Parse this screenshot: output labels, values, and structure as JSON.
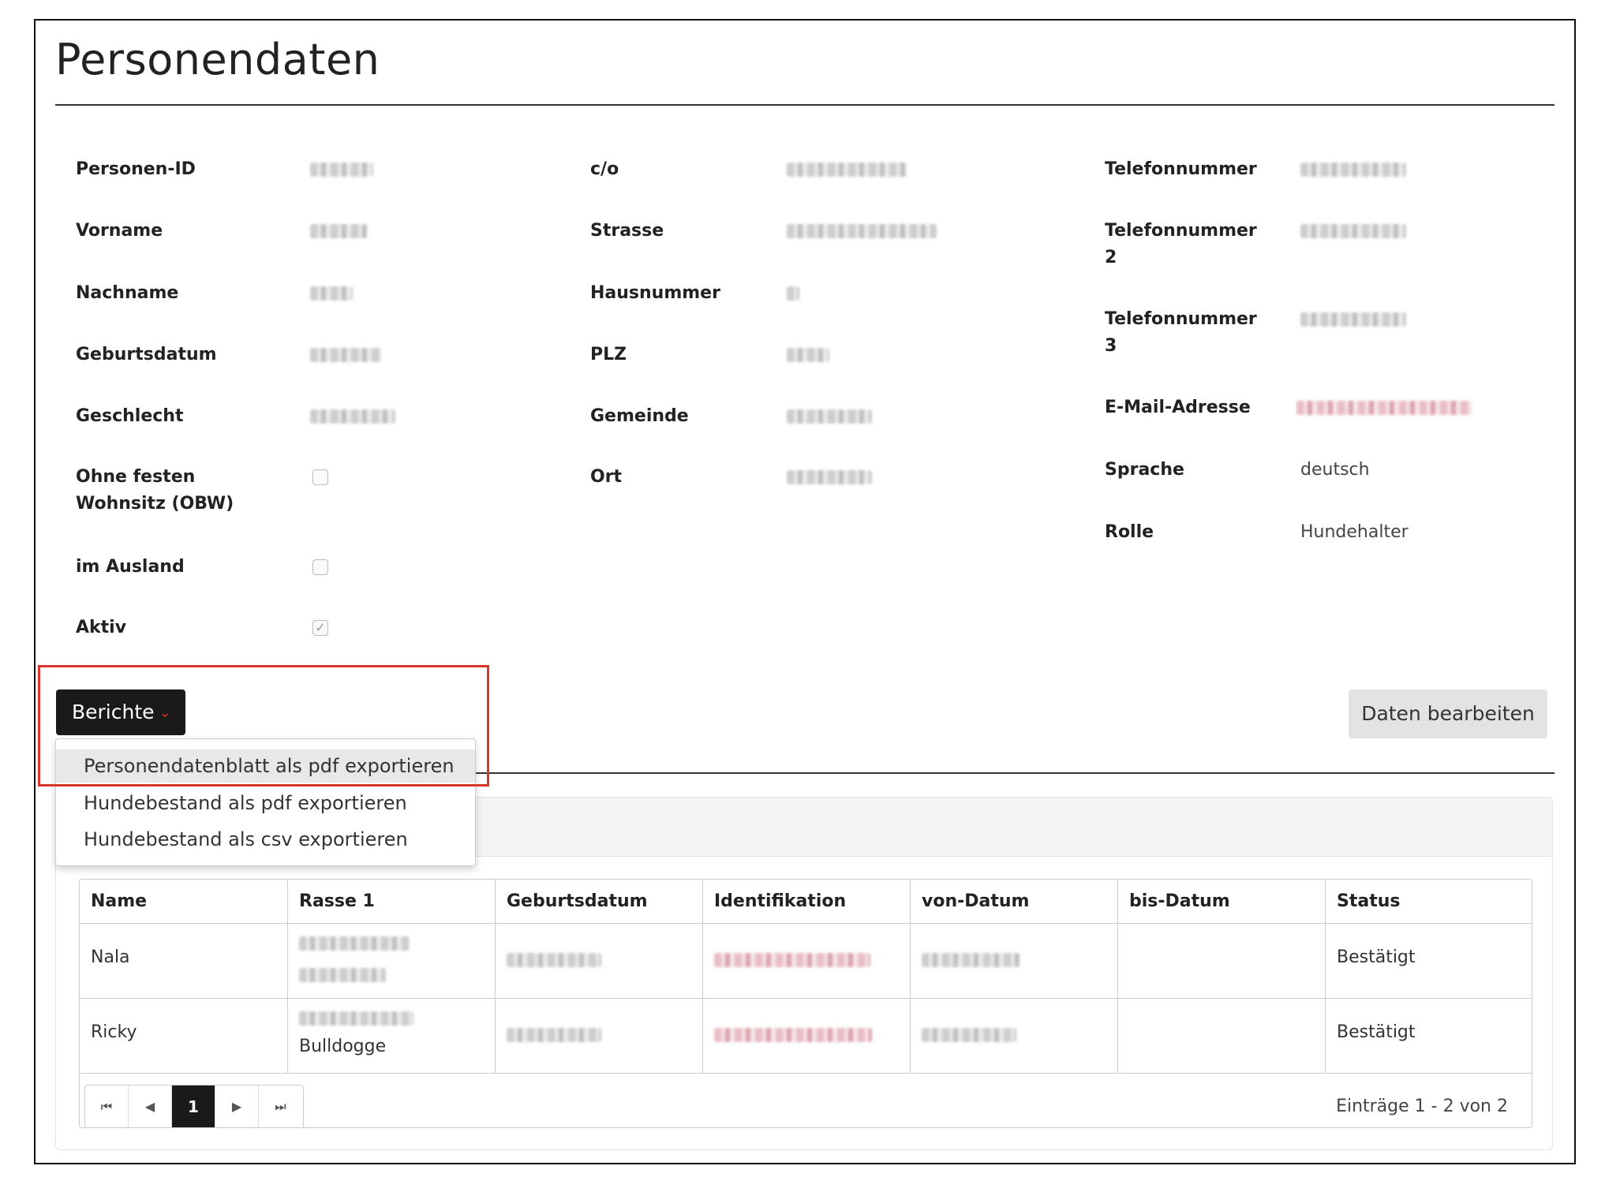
{
  "page": {
    "title": "Personendaten"
  },
  "col1": {
    "person_id": "Personen-ID",
    "vorname": "Vorname",
    "nachname": "Nachname",
    "geburtsdatum": "Geburtsdatum",
    "geschlecht": "Geschlecht",
    "ohne_festen_line1": "Ohne festen",
    "ohne_festen_line2": "Wohnsitz (OBW)",
    "im_ausland": "im Ausland",
    "aktiv": "Aktiv"
  },
  "col2": {
    "co": "c/o",
    "strasse": "Strasse",
    "hausnummer": "Hausnummer",
    "plz": "PLZ",
    "gemeinde": "Gemeinde",
    "ort": "Ort"
  },
  "col3": {
    "telefon1": "Telefonnummer",
    "telefon2_line1": "Telefonnummer",
    "telefon2_line2": "2",
    "telefon3_line1": "Telefonnummer",
    "telefon3_line2": "3",
    "email": "E-Mail-Adresse",
    "sprache": "Sprache",
    "sprache_value": "deutsch",
    "rolle": "Rolle",
    "rolle_value": "Hundehalter"
  },
  "checkboxes": {
    "ohne_festen": false,
    "im_ausland": false,
    "aktiv": true
  },
  "buttons": {
    "berichte": "Berichte",
    "chevron": "⌄",
    "edit": "Daten bearbeiten"
  },
  "dropdown": {
    "items": [
      "Personendatenblatt als pdf exportieren",
      "Hundebestand als pdf exportieren",
      "Hundebestand als csv exportieren"
    ]
  },
  "table": {
    "headers": [
      "Name",
      "Rasse 1",
      "Geburtsdatum",
      "Identifikation",
      "von-Datum",
      "bis-Datum",
      "Status"
    ],
    "rows": [
      {
        "name": "Nala",
        "status": "Bestätigt"
      },
      {
        "name": "Ricky",
        "rasse_partial": "Bulldogge",
        "status": "Bestätigt"
      }
    ]
  },
  "pager": {
    "first": "⏮",
    "prev": "◀",
    "current": "1",
    "next": "▶",
    "last": "⏭",
    "info": "Einträge 1 - 2 von 2"
  },
  "colors": {
    "accent_red": "#d9352a",
    "link_red": "#a33a35",
    "dark_button": "#1a1a1a"
  }
}
